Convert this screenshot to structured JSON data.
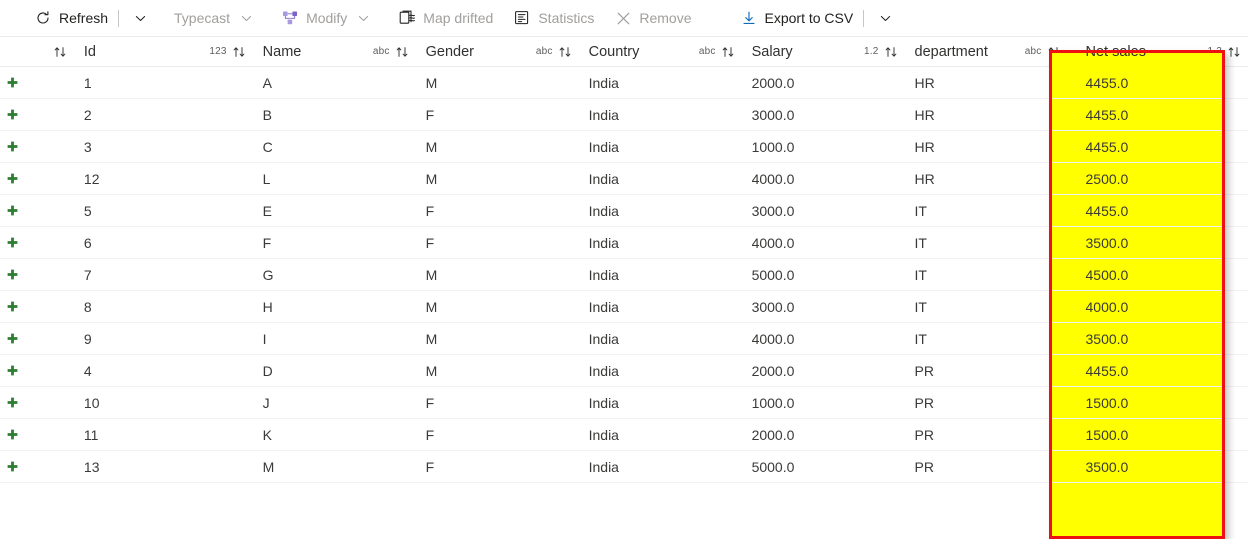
{
  "toolbar": {
    "items": [
      {
        "label": "Refresh",
        "icon": "refresh-icon",
        "disabled": false,
        "split": true
      },
      {
        "label": "Typecast",
        "icon": "none",
        "disabled": true,
        "caret": true
      },
      {
        "label": "Modify",
        "icon": "modify-nodes-icon",
        "disabled": true,
        "caret": true
      },
      {
        "label": "Map drifted",
        "icon": "map-drifted-icon",
        "disabled": true,
        "caret": false
      },
      {
        "label": "Statistics",
        "icon": "statistics-icon",
        "disabled": true,
        "caret": false
      },
      {
        "label": "Remove",
        "icon": "remove-x-icon",
        "disabled": true,
        "caret": false
      },
      {
        "label": "Export to CSV",
        "icon": "download-icon",
        "disabled": false,
        "split": true
      }
    ]
  },
  "grid": {
    "columns": [
      {
        "label": "Id",
        "type_tag": "123"
      },
      {
        "label": "Name",
        "type_tag": "abc"
      },
      {
        "label": "Gender",
        "type_tag": "abc"
      },
      {
        "label": "Country",
        "type_tag": "abc"
      },
      {
        "label": "Salary",
        "type_tag": "1.2"
      },
      {
        "label": "department",
        "type_tag": "abc"
      },
      {
        "label": "Net sales",
        "type_tag": "1.2"
      }
    ],
    "sort_icon": "sort-ascending-descending-icon",
    "row_grip_icon": "drag-handle-plus-icon",
    "highlight": {
      "column": "Net sales",
      "fill_color": "#ffff00",
      "border_color": "#ee1111"
    },
    "rows": [
      {
        "id": "1",
        "name": "A",
        "gender": "M",
        "country": "India",
        "salary": "2000.0",
        "department": "HR",
        "net_sales": "4455.0"
      },
      {
        "id": "2",
        "name": "B",
        "gender": "F",
        "country": "India",
        "salary": "3000.0",
        "department": "HR",
        "net_sales": "4455.0"
      },
      {
        "id": "3",
        "name": "C",
        "gender": "M",
        "country": "India",
        "salary": "1000.0",
        "department": "HR",
        "net_sales": "4455.0"
      },
      {
        "id": "12",
        "name": "L",
        "gender": "M",
        "country": "India",
        "salary": "4000.0",
        "department": "HR",
        "net_sales": "2500.0"
      },
      {
        "id": "5",
        "name": "E",
        "gender": "F",
        "country": "India",
        "salary": "3000.0",
        "department": "IT",
        "net_sales": "4455.0"
      },
      {
        "id": "6",
        "name": "F",
        "gender": "F",
        "country": "India",
        "salary": "4000.0",
        "department": "IT",
        "net_sales": "3500.0"
      },
      {
        "id": "7",
        "name": "G",
        "gender": "M",
        "country": "India",
        "salary": "5000.0",
        "department": "IT",
        "net_sales": "4500.0"
      },
      {
        "id": "8",
        "name": "H",
        "gender": "M",
        "country": "India",
        "salary": "3000.0",
        "department": "IT",
        "net_sales": "4000.0"
      },
      {
        "id": "9",
        "name": "I",
        "gender": "M",
        "country": "India",
        "salary": "4000.0",
        "department": "IT",
        "net_sales": "3500.0"
      },
      {
        "id": "4",
        "name": "D",
        "gender": "M",
        "country": "India",
        "salary": "2000.0",
        "department": "PR",
        "net_sales": "4455.0"
      },
      {
        "id": "10",
        "name": "J",
        "gender": "F",
        "country": "India",
        "salary": "1000.0",
        "department": "PR",
        "net_sales": "1500.0"
      },
      {
        "id": "11",
        "name": "K",
        "gender": "F",
        "country": "India",
        "salary": "2000.0",
        "department": "PR",
        "net_sales": "1500.0"
      },
      {
        "id": "13",
        "name": "M",
        "gender": "F",
        "country": "India",
        "salary": "5000.0",
        "department": "PR",
        "net_sales": "3500.0"
      }
    ]
  }
}
